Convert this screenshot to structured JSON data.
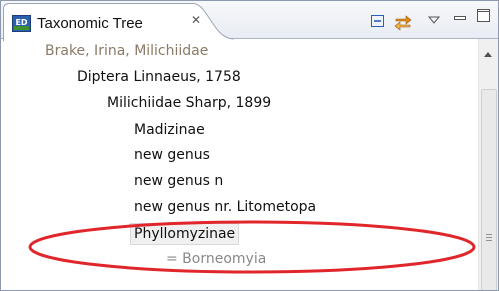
{
  "tab": {
    "title": "Taxonomic Tree",
    "close_glyph": "✕",
    "icon": "ed-app-icon",
    "icon_label": "ED"
  },
  "toolbar": {
    "collapse_icon": "collapse-all-icon",
    "link_icon": "link-with-editor-icon",
    "menu_icon": "view-menu-chevron-icon",
    "minimize_icon": "minimize-icon",
    "maximize_icon": "maximize-icon"
  },
  "tree": {
    "nodes": [
      {
        "label": "Brake, Irina, Milichiidae",
        "level": 0,
        "style": "muted"
      },
      {
        "label": "Diptera Linnaeus, 1758",
        "level": 1,
        "style": "normal"
      },
      {
        "label": "Milichiidae Sharp, 1899",
        "level": 2,
        "style": "normal"
      },
      {
        "label": "Madizinae",
        "level": 3,
        "style": "normal"
      },
      {
        "label": "new genus",
        "level": 3,
        "style": "normal"
      },
      {
        "label": "new genus n",
        "level": 3,
        "style": "normal"
      },
      {
        "label": "new genus nr. Litometopa",
        "level": 3,
        "style": "normal"
      },
      {
        "label": "Phyllomyzinae",
        "level": 3,
        "style": "selected"
      },
      {
        "label": "= Borneomyia",
        "level": 4,
        "style": "synonym"
      }
    ]
  },
  "annotation": {
    "color": "#e0262b"
  },
  "colors": {
    "accent_blue": "#2b5fb0",
    "icon_green": "#3f8f2e",
    "icon_orange": "#e08a1e"
  }
}
